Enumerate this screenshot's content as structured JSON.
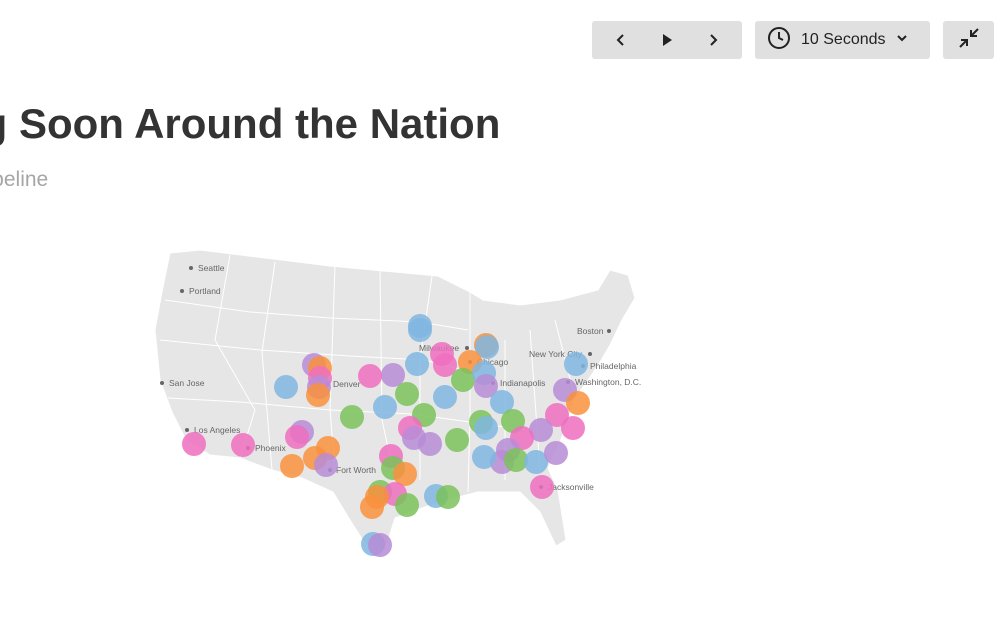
{
  "header": {
    "title": "ng Soon Around the Nation",
    "subtitle": "n Pipeline"
  },
  "controls": {
    "prev_icon": "chevron-left-icon",
    "play_icon": "play-icon",
    "next_icon": "chevron-right-icon",
    "timer_icon": "clock-icon",
    "timer_label": "10 Seconds",
    "dropdown_icon": "chevron-down-icon",
    "collapse_icon": "collapse-icon"
  },
  "colors": {
    "button_bg": "#e0e0e0",
    "map_fill": "#e6e6e6",
    "title": "#333333",
    "subtitle": "#a6a6a6",
    "blue": "#7fb6e0",
    "orange": "#f9913d",
    "green": "#7ac25a",
    "pink": "#ee6fc0",
    "purple": "#b78cd6"
  },
  "map": {
    "cities": [
      {
        "name": "Seattle"
      },
      {
        "name": "Portland"
      },
      {
        "name": "San Jose"
      },
      {
        "name": "Los Angeles"
      },
      {
        "name": "Phoenix"
      },
      {
        "name": "Denver"
      },
      {
        "name": "Fort Worth"
      },
      {
        "name": "Milwaukee"
      },
      {
        "name": "Chicago"
      },
      {
        "name": "Indianapolis"
      },
      {
        "name": "New York City"
      },
      {
        "name": "Boston"
      },
      {
        "name": "Philadelphia"
      },
      {
        "name": "Washington, D.C."
      },
      {
        "name": "Jacksonville"
      }
    ]
  }
}
